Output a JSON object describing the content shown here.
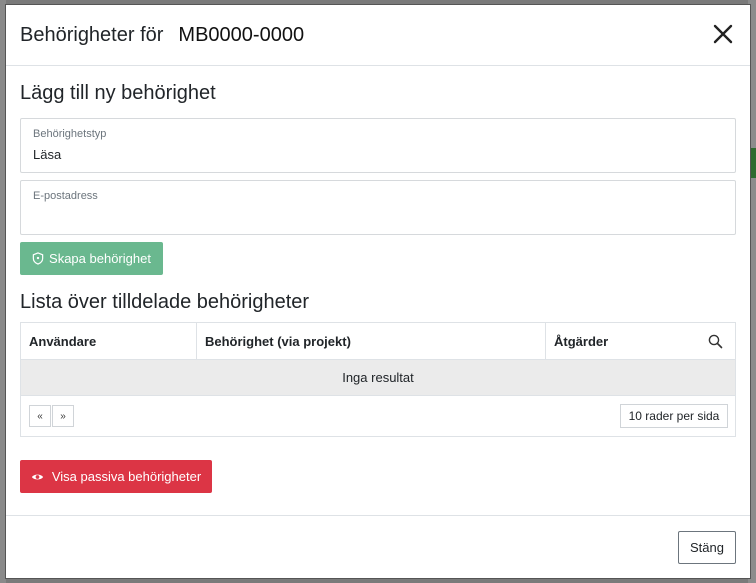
{
  "modal": {
    "title_label": "Behörigheter för",
    "title_id": "MB0000-0000",
    "close_icon": "close-icon"
  },
  "add_section": {
    "title": "Lägg till ny behörighet",
    "type_field": {
      "label": "Behörighetstyp",
      "value": "Läsa"
    },
    "email_field": {
      "label": "E-postadress",
      "value": "",
      "placeholder": ""
    },
    "create_button": {
      "label": "Skapa behörighet",
      "icon": "shield-icon",
      "color": "#6ab88f"
    }
  },
  "list_section": {
    "title": "Lista över tilldelade behörigheter",
    "columns": [
      "Användare",
      "Behörighet (via projekt)",
      "Åtgärder"
    ],
    "empty_text": "Inga resultat",
    "pager": {
      "prev": "«",
      "next": "»",
      "rows_per_page": "10 rader per sida"
    }
  },
  "passive_button": {
    "label": "Visa passiva behörigheter",
    "icon": "eye-icon",
    "color": "#dc3545"
  },
  "footer": {
    "close_label": "Stäng"
  }
}
